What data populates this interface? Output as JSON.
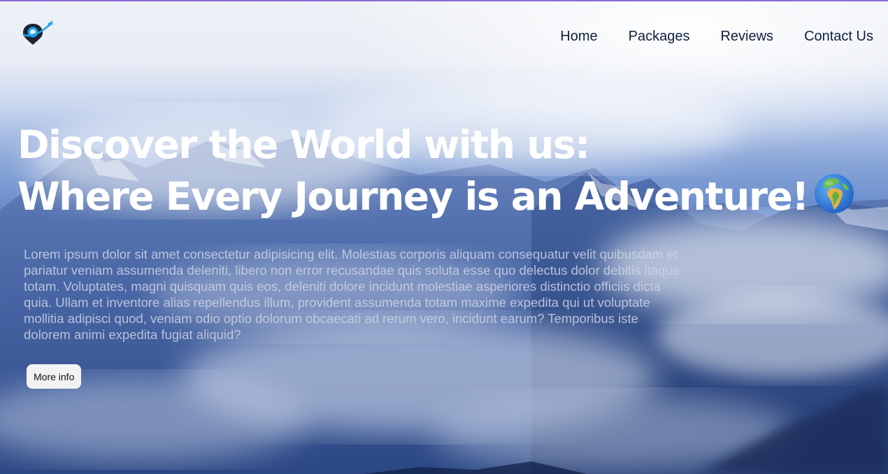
{
  "brand": {
    "logo_icon": "location-pin-plane-icon"
  },
  "nav": {
    "items": [
      {
        "label": "Home"
      },
      {
        "label": "Packages"
      },
      {
        "label": "Reviews"
      },
      {
        "label": "Contact Us"
      }
    ]
  },
  "hero": {
    "headline_line1": "Discover the World with us:",
    "headline_line2": "Where Every Journey is an Adventure!",
    "headline_icon": "globe-europe-africa-icon",
    "body": "Lorem ipsum dolor sit amet consectetur adipisicing elit. Molestias corporis aliquam consequatur velit quibusdam et pariatur veniam assumenda deleniti, libero non error recusandae quis soluta esse quo delectus dolor debitis itaque totam. Voluptates, magni quisquam quis eos, deleniti dolore incidunt molestiae asperiores distinctio officiis dicta quia. Ullam et inventore alias repellendus illum, provident assumenda totam maxime expedita qui ut voluptate mollitia adipisci quod, veniam odio optio dolorum obcaecati ad rerum vero, incidunt earum? Temporibus iste dolorem animi expedita fugiat aliquid?",
    "button_label": "More info",
    "background": "snowy-mountains-clouds-image"
  },
  "colors": {
    "nav_text": "#0f1f3d",
    "headline": "#ffffff",
    "accent_line": "#8a6bd6",
    "logo_blue": "#1aa3e8",
    "logo_dark": "#1c2333"
  }
}
